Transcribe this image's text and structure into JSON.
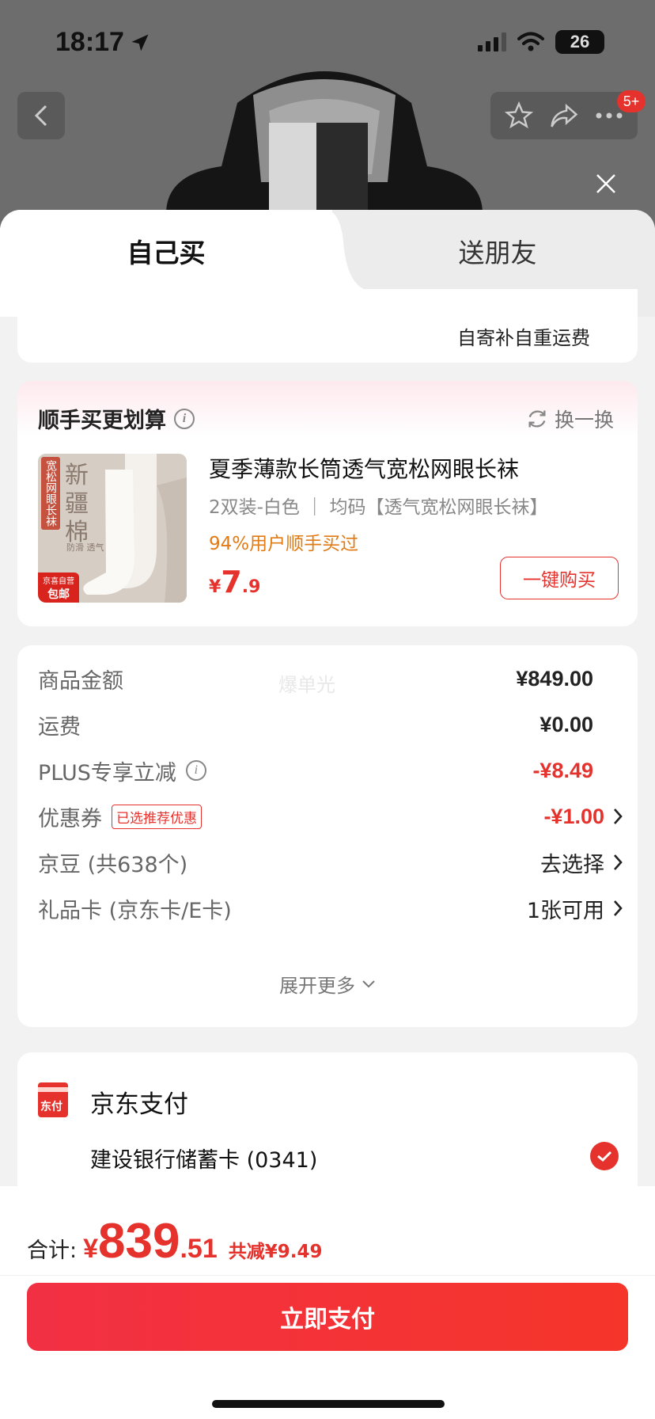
{
  "status_bar": {
    "time": "18:17",
    "battery": "26"
  },
  "nav": {
    "badge": "5+"
  },
  "tabs": [
    {
      "label": "自己买",
      "active": true
    },
    {
      "label": "送朋友",
      "active": false
    }
  ],
  "shipping_note": "自寄补自重运费",
  "addon": {
    "title": "顺手买更划算",
    "refresh_label": "换一换",
    "name": "夏季薄款长筒透气宽松网眼长袜",
    "spec": "2双装-白色 ｜ 均码【透气宽松网眼长袜】",
    "stat": "94%用户顺手买过",
    "price_symbol": "¥",
    "price_int": "7",
    "price_dec": ".9",
    "buy_label": "一键购买",
    "thumb": {
      "text_new": "新",
      "text_region": "疆",
      "text_cotton": "棉",
      "text_side": "宽松网眼长袜",
      "text_feature": "防滑 透气",
      "badge_top": "京喜自营",
      "badge_bottom": "包邮"
    }
  },
  "summary": {
    "watermark": "爆单光",
    "rows": [
      {
        "label": "商品金额",
        "value": "¥849.00"
      },
      {
        "label": "运费",
        "value": "¥0.00"
      },
      {
        "label": "PLUS专享立减",
        "value": "-¥8.49"
      },
      {
        "label": "优惠券",
        "tag": "已选推荐优惠",
        "value": "-¥1.00"
      },
      {
        "label": "京豆 (共638个)",
        "value": "去选择"
      },
      {
        "label": "礼品卡 (京东卡/E卡)",
        "value": "1张可用"
      }
    ],
    "expand_label": "展开更多"
  },
  "payment": {
    "icon_text": "东付",
    "title": "京东支付",
    "card": "建设银行储蓄卡 (0341)"
  },
  "bottom": {
    "total_label": "合计:",
    "currency": "¥",
    "total_int": "839",
    "total_dec": ".51",
    "saved": "共减¥9.49",
    "pay_label": "立即支付"
  },
  "colors": {
    "accent": "#e5322d",
    "orange": "#e07b15",
    "background": "#f2f2f2"
  },
  "icons": [
    "location-arrow-icon",
    "signal-icon",
    "wifi-icon",
    "back-icon",
    "star-icon",
    "share-icon",
    "more-icon",
    "close-icon",
    "info-icon",
    "refresh-icon",
    "chevron-right-icon",
    "chevron-down-icon",
    "check-icon"
  ]
}
